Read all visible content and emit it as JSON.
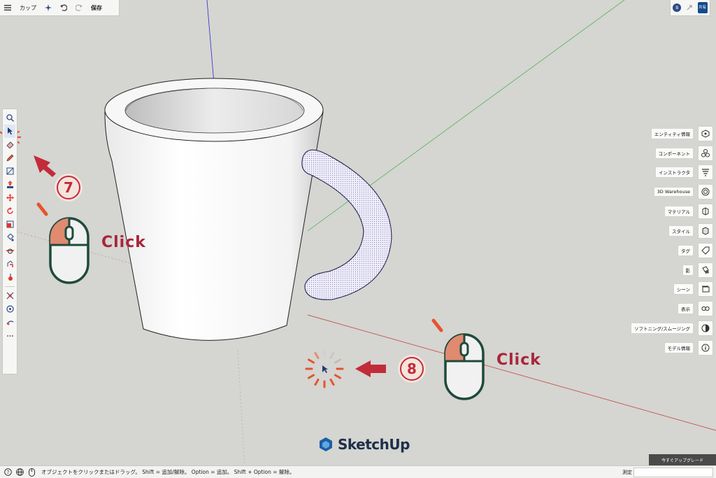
{
  "toolbar": {
    "model_name": "カップ",
    "save_label": "保存",
    "menu_icon": "menu-icon",
    "search_icon": "sparkle-search-icon",
    "undo_icon": "undo-icon",
    "redo_icon": "redo-icon"
  },
  "account": {
    "avatar_initial": "B",
    "share_label": "共有"
  },
  "left_tools": [
    "search-icon",
    "select-icon",
    "eraser-icon",
    "pencil-icon",
    "rectangle-icon",
    "push-pull-icon",
    "move-icon",
    "rotate-icon",
    "scale-icon",
    "paint-bucket-icon",
    "tape-measure-icon",
    "follow-me-icon",
    "walk-icon",
    "orbit-icon",
    "zoom-extents-icon",
    "camera-icon",
    "more-icon"
  ],
  "tray": [
    {
      "label": "エンティティ情報",
      "icon": "entity-info-icon"
    },
    {
      "label": "コンポーネント",
      "icon": "components-icon"
    },
    {
      "label": "インストラクタ",
      "icon": "instructor-icon"
    },
    {
      "label": "3D Warehouse",
      "icon": "warehouse-icon"
    },
    {
      "label": "マテリアル",
      "icon": "materials-icon"
    },
    {
      "label": "スタイル",
      "icon": "styles-icon"
    },
    {
      "label": "タグ",
      "icon": "tags-icon"
    },
    {
      "label": "影",
      "icon": "shadows-icon"
    },
    {
      "label": "シーン",
      "icon": "scenes-icon"
    },
    {
      "label": "表示",
      "icon": "display-icon"
    },
    {
      "label": "ソフトニング/スムージング",
      "icon": "soften-icon"
    },
    {
      "label": "モデル情報",
      "icon": "model-info-icon"
    }
  ],
  "status": {
    "message": "オブジェクトをクリックまたはドラッグ。 Shift = 追加/解除。 Option = 追加。 Shift + Option = 解除。",
    "measure_label": "測定",
    "measure_value": ""
  },
  "upgrade_label": "今すぐアップグレード",
  "brand": "SketchUp",
  "annotations": {
    "step7": "7",
    "step8": "8",
    "click1": "Click",
    "click2": "Click"
  },
  "colors": {
    "accent_red": "#c22b39",
    "mouse_outline": "#1f4a3a",
    "mouse_button": "#e08a70"
  }
}
